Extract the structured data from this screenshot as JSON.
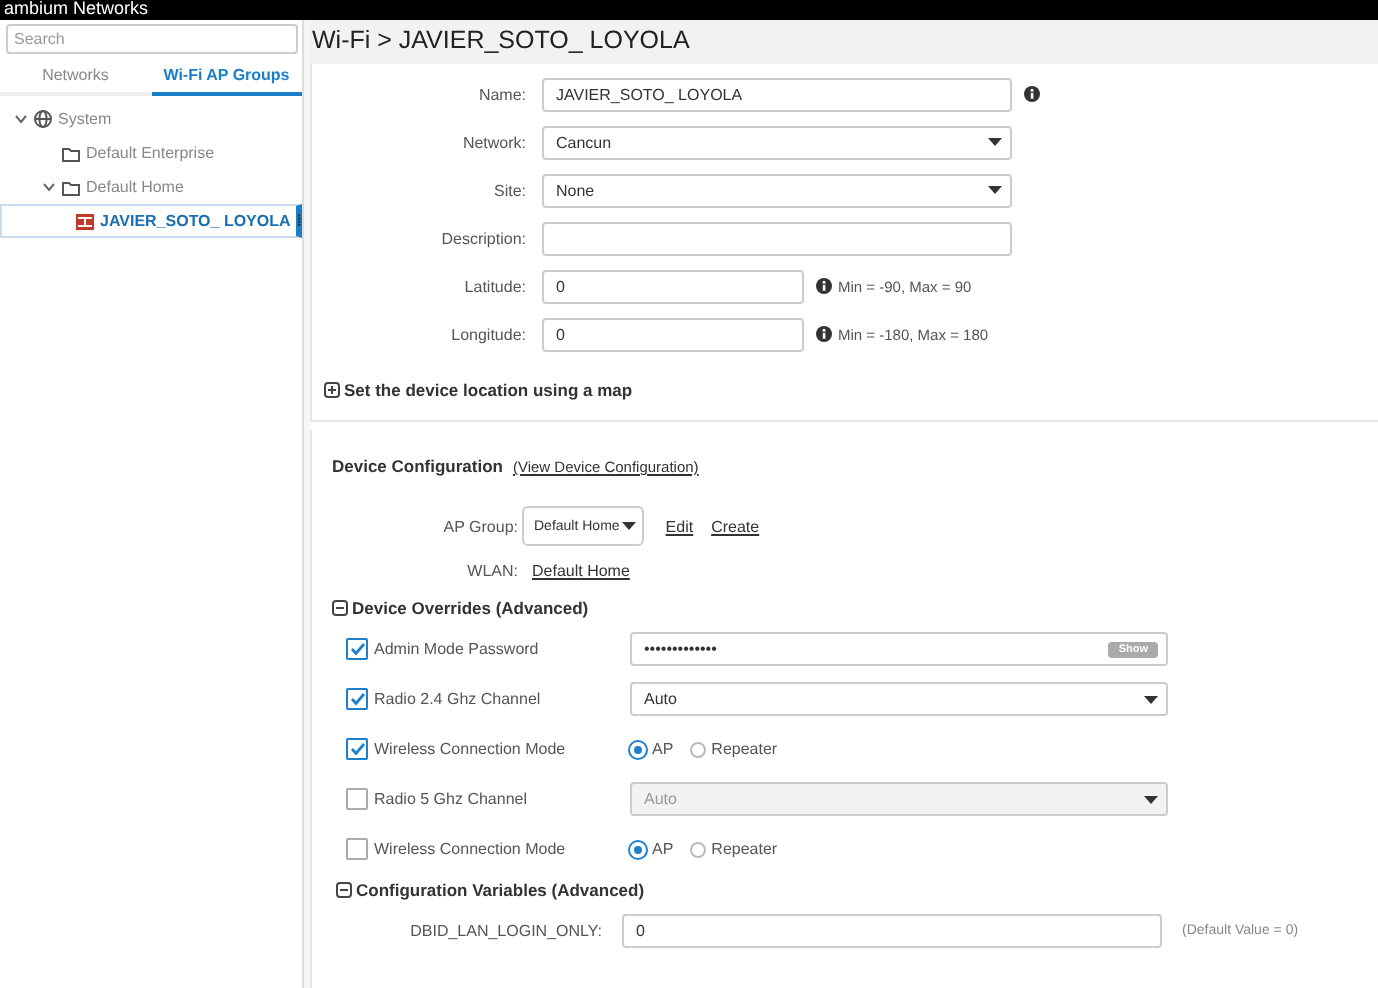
{
  "top_bar": {
    "text": "ambium Networks"
  },
  "sidebar": {
    "search": {
      "placeholder": "Search"
    },
    "tabs": [
      {
        "label": "Networks",
        "selected": false
      },
      {
        "label": "Wi-Fi AP Groups",
        "selected": true
      }
    ],
    "tree": [
      {
        "label": "System",
        "kind": "globe",
        "expanded": true,
        "selected": false,
        "children": [
          {
            "label": "Default Enterprise",
            "kind": "folder",
            "selected": false
          },
          {
            "label": "Default Home",
            "kind": "folder",
            "expanded": true,
            "selected": false,
            "children": [
              {
                "label": "JAVIER_SOTO_ LOYOLA",
                "kind": "device",
                "selected": true,
                "menu": "⁞"
              }
            ]
          }
        ]
      }
    ]
  },
  "page_title": "Wi-Fi > JAVIER_SOTO_ LOYOLA",
  "fields": [
    {
      "label": "Name:",
      "kind": "text",
      "value": "JAVIER_SOTO_ LOYOLA",
      "info": true
    },
    {
      "label": "Network:",
      "kind": "select",
      "value": "Cancun"
    },
    {
      "label": "Site:",
      "kind": "select",
      "value": "None"
    },
    {
      "label": "Description:",
      "kind": "text"
    },
    {
      "label": "Latitude:",
      "kind": "short",
      "value": "0",
      "hint": "Min = -90, Max = 90"
    },
    {
      "label": "Longitude:",
      "kind": "short",
      "value": "0",
      "hint": "Min = -180, Max = 180"
    }
  ],
  "map_section": {
    "title": "Set the device location using a map",
    "expanded": false
  },
  "device_configuration": {
    "title": "Device Configuration",
    "link": "(View Device Configuration)",
    "ap_group": {
      "label": "AP Group:",
      "value": "Default Home",
      "links": [
        "Edit",
        "Create"
      ]
    },
    "wlan": {
      "label": "WLAN:",
      "value": "Default Home"
    }
  },
  "overrides": {
    "title": "Device Overrides (Advanced)",
    "expanded": true,
    "items": [
      {
        "label": "Admin Mode Password",
        "checked": true,
        "kind": "password",
        "value": "•••••••••••••",
        "button": "Show"
      },
      {
        "label": "Radio 2.4 Ghz Channel",
        "checked": true,
        "kind": "select",
        "value": "Auto"
      },
      {
        "label": "Wireless Connection Mode",
        "checked": true,
        "kind": "radio",
        "options": [
          {
            "label": "AP",
            "selected": true
          },
          {
            "label": "Repeater",
            "selected": false
          }
        ]
      },
      {
        "label": "Radio 5 Ghz Channel",
        "checked": false,
        "kind": "select",
        "value": "Auto"
      },
      {
        "label": "Wireless Connection Mode",
        "checked": false,
        "kind": "radio",
        "options": [
          {
            "label": "AP",
            "selected": true
          },
          {
            "label": "Repeater",
            "selected": false
          }
        ]
      }
    ]
  },
  "config_variables": {
    "title": "Configuration Variables (Advanced)",
    "expanded": true,
    "items": [
      {
        "label": "DBID_LAN_LOGIN_ONLY:",
        "value": "0",
        "hint": "(Default Value = 0)"
      }
    ]
  }
}
